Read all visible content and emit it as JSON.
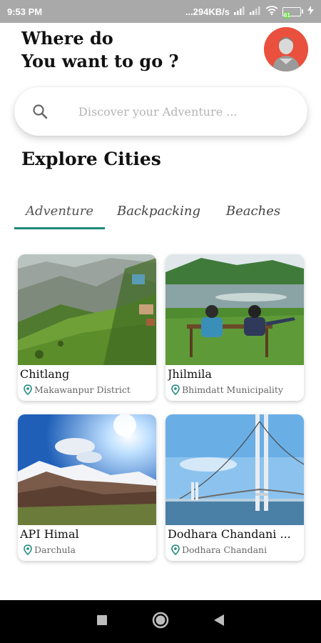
{
  "status_bar": {
    "time": "9:53 PM",
    "net_speed": "...294KB/s",
    "battery_level": "61"
  },
  "header": {
    "line1": "Where do",
    "line2": "You want to go ?"
  },
  "search": {
    "placeholder": "Discover your Adventure ..."
  },
  "section": {
    "title": "Explore Cities"
  },
  "tabs": [
    {
      "label": "Adventure",
      "active": true
    },
    {
      "label": "Backpacking",
      "active": false
    },
    {
      "label": "Beaches",
      "active": false
    }
  ],
  "cities": [
    {
      "name": "Chitlang",
      "location": "Makawanpur District"
    },
    {
      "name": "Jhilmila",
      "location": "Bhimdatt Municipality"
    },
    {
      "name": "API Himal",
      "location": "Darchula"
    },
    {
      "name": "Dodhara Chandani ...",
      "location": "Dodhara Chandani"
    }
  ],
  "colors": {
    "accent": "#1c8a7a",
    "avatar_bg": "#e9503d",
    "pin": "#1c8a7a"
  }
}
